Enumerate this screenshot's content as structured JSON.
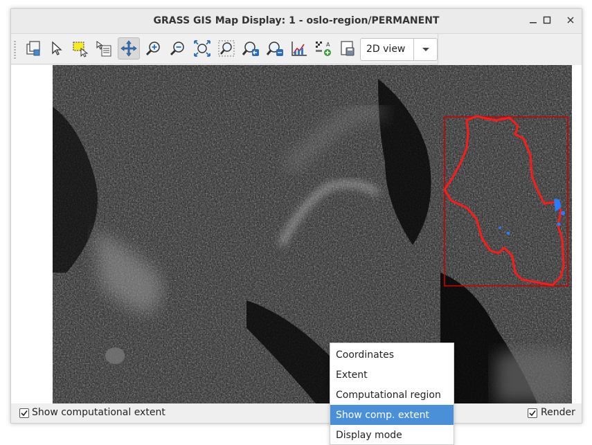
{
  "window": {
    "title": "GRASS GIS Map Display: 1 - oslo-region/PERMANENT",
    "controls": [
      "minimize",
      "maximize",
      "close"
    ]
  },
  "toolbar": {
    "tools": [
      {
        "name": "render-map-tool",
        "icon": "layers-render-icon"
      },
      {
        "name": "pointer-tool",
        "icon": "pointer-icon"
      },
      {
        "name": "select-tool",
        "icon": "selection-rectangle-icon"
      },
      {
        "name": "query-tool",
        "icon": "query-info-icon"
      },
      {
        "name": "pan-tool",
        "icon": "pan-arrows-icon",
        "active": true
      },
      {
        "name": "zoom-in-tool",
        "icon": "zoom-in-icon"
      },
      {
        "name": "zoom-out-tool",
        "icon": "zoom-out-icon"
      },
      {
        "name": "zoom-extent-tool",
        "icon": "zoom-extent-icon"
      },
      {
        "name": "zoom-region-tool",
        "icon": "zoom-region-icon"
      },
      {
        "name": "zoom-back-tool",
        "icon": "zoom-back-icon"
      },
      {
        "name": "zoom-menu-tool",
        "icon": "zoom-options-icon"
      },
      {
        "name": "analyze-tool",
        "icon": "chart-analyze-icon"
      },
      {
        "name": "overlay-tool",
        "icon": "legend-overlay-icon"
      },
      {
        "name": "save-image-tool",
        "icon": "save-display-icon"
      }
    ],
    "view_mode": "2D view"
  },
  "statusbar": {
    "show_extent_label": "Show computational extent",
    "show_extent_checked": true,
    "render_label": "Render",
    "render_checked": true
  },
  "context_menu": {
    "items": [
      "Coordinates",
      "Extent",
      "Computational region",
      "Show comp. extent",
      "Display mode"
    ],
    "selected_index": 3
  },
  "colors": {
    "region_outline": "#ff1a1a",
    "extent_box": "#cc0000",
    "water": "#2b7bff",
    "menu_highlight": "#4a90d9"
  }
}
